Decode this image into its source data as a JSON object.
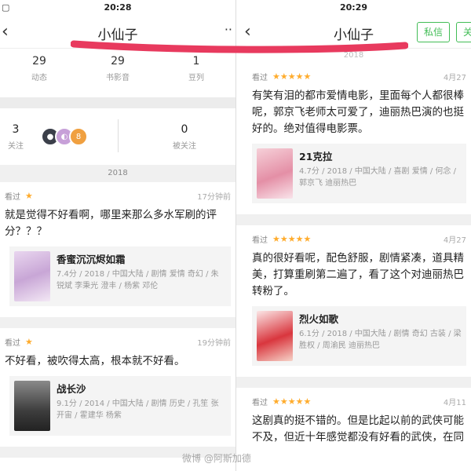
{
  "left": {
    "status_time": "20:28",
    "title": "小仙子",
    "stats": [
      {
        "num": "29",
        "label": "动态"
      },
      {
        "num": "29",
        "label": "书影音"
      },
      {
        "num": "1",
        "label": "豆列"
      }
    ],
    "following_num": "3",
    "following_label": "关注",
    "followers_num": "0",
    "followers_label": "被关注",
    "avatar_badge": "8",
    "year": "2018",
    "reviews": [
      {
        "status": "看过",
        "rating": 1,
        "time": "17分钟前",
        "text": "就是觉得不好看啊，哪里来那么多水军刷的评分？？？",
        "movie_title": "香蜜沉沉烬如霜",
        "movie_meta": "7.4分 / 2018 / 中国大陆 / 剧情 爱情 奇幻 / 朱锐斌 李秉光 澄丰 / 杨紫 邓伦"
      },
      {
        "status": "看过",
        "rating": 1,
        "time": "19分钟前",
        "text": "不好看，被吹得太高，根本就不好看。",
        "movie_title": "战长沙",
        "movie_meta": "9.1分 / 2014 / 中国大陆 / 剧情 历史 / 孔笙 张开宙 / 霍建华 杨紫"
      }
    ]
  },
  "right": {
    "status_time": "20:29",
    "title": "小仙子",
    "message_label": "私信",
    "follow_label": "关",
    "year": "2018",
    "reviews": [
      {
        "status": "看过",
        "rating": 5,
        "time": "4月27",
        "text": "有笑有泪的都市爱情电影，里面每个人都很棒呢，郭京飞老师太可爱了，迪丽热巴演的也挺好的。绝对值得电影票。",
        "movie_title": "21克拉",
        "movie_meta": "4.7分 / 2018 / 中国大陆 / 喜剧 爱情 / 何念 / 郭京飞 迪丽热巴"
      },
      {
        "status": "看过",
        "rating": 5,
        "time": "4月27",
        "text": "真的很好看呢，配色舒服，剧情紧凑，道具精美，打算重刷第二遍了，看了这个对迪丽热巴转粉了。",
        "movie_title": "烈火如歌",
        "movie_meta": "6.1分 / 2018 / 中国大陆 / 剧情 奇幻 古装 / 梁胜权 / 周渝民 迪丽热巴"
      },
      {
        "status": "看过",
        "rating": 5,
        "time": "4月11",
        "text": "这剧真的挺不错的。但是比起以前的武侠可能不及，但近十年感觉都没有好看的武侠，在同",
        "movie_title": "",
        "movie_meta": ""
      }
    ]
  },
  "watermark": "微博 @阿斯加德"
}
